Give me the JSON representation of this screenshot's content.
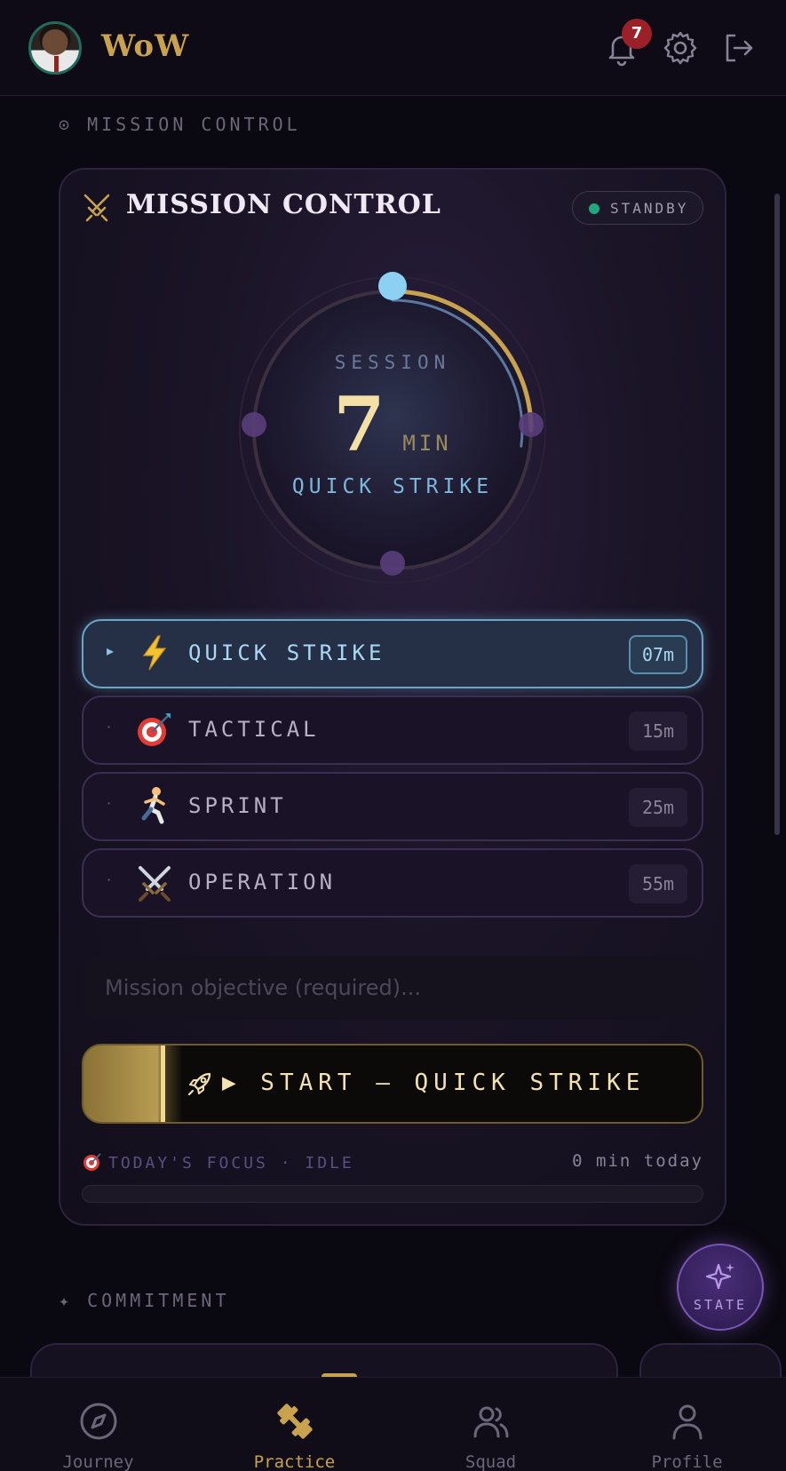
{
  "header": {
    "brand": "WoW",
    "notification_count": "7"
  },
  "section_mission": {
    "label": "⊙ MISSION CONTROL"
  },
  "mission_card": {
    "title": "MISSION CONTROL",
    "status": "STANDBY",
    "dial": {
      "session_label": "SESSION",
      "minutes": "7",
      "unit": "MIN",
      "mode_label": "QUICK STRIKE",
      "progress_fraction": 0.25
    },
    "modes": [
      {
        "marker": "▸",
        "icon": "lightning-icon",
        "name": "QUICK STRIKE",
        "duration": "07m",
        "active": true
      },
      {
        "marker": "·",
        "icon": "target-icon",
        "name": "TACTICAL",
        "duration": "15m",
        "active": false
      },
      {
        "marker": "·",
        "icon": "runner-icon",
        "name": "SPRINT",
        "duration": "25m",
        "active": false
      },
      {
        "marker": "·",
        "icon": "crossed-swords-icon",
        "name": "OPERATION",
        "duration": "55m",
        "active": false
      }
    ],
    "objective_placeholder": "Mission objective (required)...",
    "start_label": "▶ START — QUICK STRIKE",
    "focus_label": "TODAY'S FOCUS · IDLE",
    "focus_today": "0 min today",
    "focus_progress": 0
  },
  "section_commitment": {
    "label": "✦ COMMITMENT"
  },
  "state_button": {
    "label": "STATE"
  },
  "bottom_nav": [
    {
      "label": "Journey",
      "icon": "compass-icon",
      "active": false
    },
    {
      "label": "Practice",
      "icon": "dumbbell-icon",
      "active": true
    },
    {
      "label": "Squad",
      "icon": "users-icon",
      "active": false
    },
    {
      "label": "Profile",
      "icon": "user-icon",
      "active": false
    }
  ],
  "colors": {
    "gold": "#c9a24e",
    "cyan": "#8cc4e4",
    "standby_green": "#1fa880",
    "badge_red": "#9b2028"
  }
}
